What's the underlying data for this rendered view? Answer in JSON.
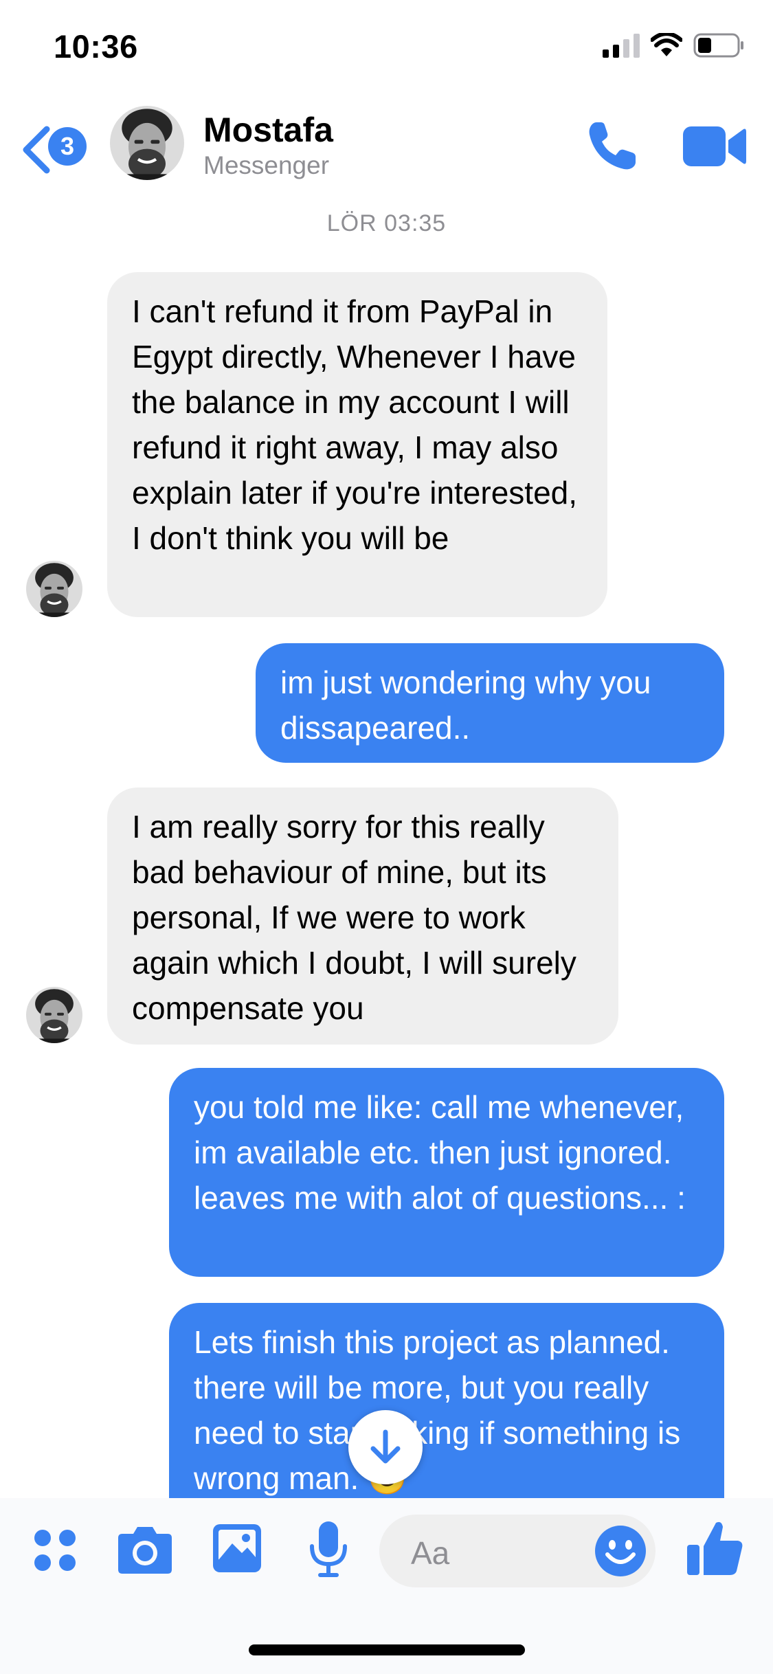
{
  "status_bar": {
    "time": "10:36",
    "icons": [
      "signal-icon",
      "wifi-icon",
      "battery-icon"
    ]
  },
  "header": {
    "back_badge": "3",
    "contact_name": "Mostafa",
    "contact_subtitle": "Messenger",
    "icons": [
      "back-chevron-icon",
      "phone-icon",
      "video-camera-icon"
    ]
  },
  "chat": {
    "timestamp": "LÖR 03:35",
    "messages": [
      {
        "sender": "contact",
        "text": "I can't refund it from PayPal in Egypt directly, Whenever I have the balance in my account I will refund it right away, I may also explain later if you're interested, I don't think you will be"
      },
      {
        "sender": "me",
        "text": "im just wondering why you dissapeared.."
      },
      {
        "sender": "contact",
        "text": "I am really sorry for this really bad behaviour of mine, but its personal, If we were to work again which I doubt, I will surely compensate you"
      },
      {
        "sender": "me",
        "text": "you told me like: call me whenever, im available etc. then just ignored. leaves me with alot of questions... :"
      },
      {
        "sender": "me",
        "text": "Lets finish this project as planned. there will be more, but you really need to start talking if something is wrong man. 🙂"
      }
    ]
  },
  "composer": {
    "placeholder": "Aa",
    "icons": [
      "apps-grid-icon",
      "camera-icon",
      "gallery-icon",
      "microphone-icon",
      "emoji-icon",
      "thumbs-up-icon"
    ]
  },
  "colors": {
    "accent": "#3a82f1",
    "incoming_bubble": "#efefef",
    "muted_text": "#8e8e93"
  }
}
